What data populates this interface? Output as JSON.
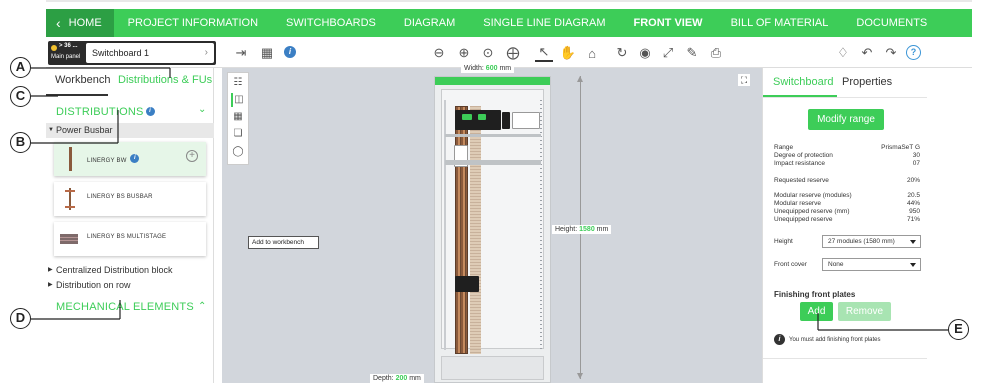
{
  "nav": {
    "home": "HOME",
    "items": [
      "PROJECT INFORMATION",
      "SWITCHBOARDS",
      "DIAGRAM",
      "SINGLE LINE DIAGRAM",
      "FRONT VIEW",
      "BILL OF MATERIAL",
      "DOCUMENTS"
    ],
    "active": "FRONT VIEW",
    "accent_color": "#3dcd58"
  },
  "toolbar": {
    "panel_badge_top": "> 36 ...",
    "panel_badge_bottom": "Main panel",
    "switchboard_name": "Switchboard 1",
    "help_label": "?"
  },
  "left_panel": {
    "tabs": [
      "Workbench",
      "Distributions & FUs"
    ],
    "active_tab": "Workbench",
    "distributions_header": "DISTRIBUTIONS",
    "power_busbar": "Power Busbar",
    "cards": [
      {
        "label": "LINERGY BW"
      },
      {
        "label": "LINERGY BS BUSBAR"
      },
      {
        "label": "LINERGY BS MULTISTAGE"
      }
    ],
    "tooltip": "Add to workbench",
    "tree": [
      "Centralized Distribution block",
      "Distribution on row"
    ],
    "mechanical_header": "MECHANICAL ELEMENTS"
  },
  "canvas": {
    "width_label": "Width:",
    "width_value": "600",
    "height_label": "Height:",
    "height_value": "1580",
    "depth_label": "Depth:",
    "depth_value": "200",
    "unit": "mm",
    "background": "#d2d6dc"
  },
  "right_panel": {
    "tabs": [
      "Switchboard",
      "Properties"
    ],
    "active_tab": "Switchboard",
    "modify_range": "Modify range",
    "props_a": [
      {
        "k": "Range",
        "v": "PrismaSeT G"
      },
      {
        "k": "Degree of protection",
        "v": "30"
      },
      {
        "k": "Impact resistance",
        "v": "07"
      }
    ],
    "props_b": [
      {
        "k": "Requested reserve",
        "v": "20%"
      }
    ],
    "props_c": [
      {
        "k": "Modular reserve (modules)",
        "v": "20.5"
      },
      {
        "k": "Modular reserve",
        "v": "44%"
      },
      {
        "k": "Unequipped reserve (mm)",
        "v": "950"
      },
      {
        "k": "Unequipped reserve",
        "v": "71%"
      }
    ],
    "height_label": "Height",
    "height_value": "27 modules (1580 mm)",
    "front_cover_label": "Front cover",
    "front_cover_value": "None",
    "finishing_title": "Finishing front plates",
    "add_label": "Add",
    "remove_label": "Remove",
    "note": "You must add finishing front plates"
  },
  "callouts": [
    "A",
    "B",
    "C",
    "D",
    "E"
  ]
}
